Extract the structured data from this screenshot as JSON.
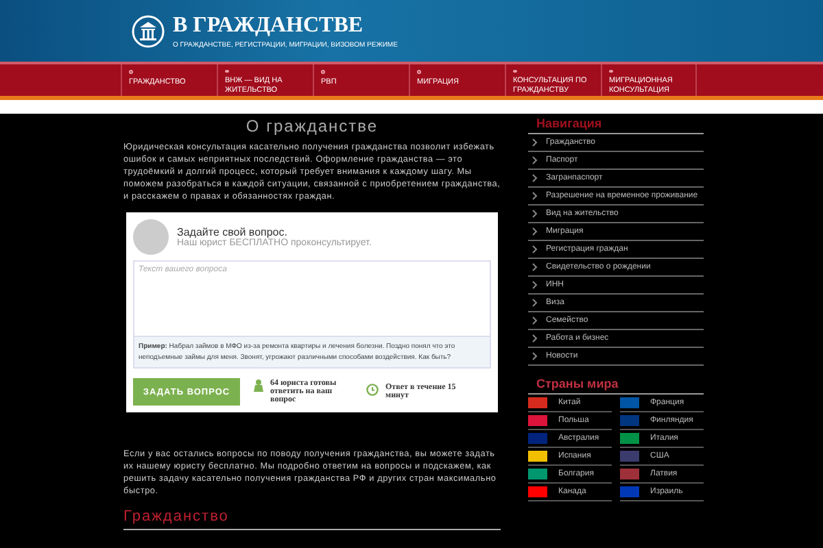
{
  "header": {
    "title": "В ГРАЖДАНСТВЕ",
    "subtitle": "О ГРАЖДАНСТВЕ, РЕГИСТРАЦИИ, МИГРАЦИИ, ВИЗОВОМ РЕЖИМЕ"
  },
  "menu": [
    "ГРАЖДАНСТВО",
    "ВНЖ — ВИД НА ЖИТЕЛЬСТВО",
    "РВП",
    "МИГРАЦИЯ",
    "КОНСУЛЬТАЦИЯ ПО ГРАЖДАНСТВУ",
    "МИГРАЦИОННАЯ КОНСУЛЬТАЦИЯ"
  ],
  "main": {
    "heading": "О гражданстве",
    "intro": "Юридическая консультация касательно получения гражданства позволит избежать ошибок и самых неприятных последствий. Оформление гражданства — это трудоёмкий и долгий процесс, который требует внимания к каждому шагу. Мы поможем разобраться в каждой ситуации, связанной с приобретением гражданства, и расскажем о правах и обязанностях граждан.",
    "question_form": {
      "title": "Задайте свой вопрос.",
      "subtitle": "Наш юрист БЕСПЛАТНО проконсультирует.",
      "placeholder": "Текст вашего вопроса",
      "example": "**Пример:** Набрал займов в МФО из-за ремонта квартиры и лечения болезни. Поздно понял что это неподъемные займы для меня. Звонят, угрожают различными способами воздействия. Как быть?",
      "button": "ЗАДАТЬ ВОПРОС",
      "lawyers": "64 юриста готовы ответить на ваш вопрос",
      "answer_time": "Ответ в течение 15 минут"
    },
    "outro": "Если у вас остались вопросы по поводу получения гражданства, вы можете задать их нашему юристу бесплатно. Мы подробно ответим на вопросы и подскажем, как решить задачу касательно получения гражданства РФ и других стран максимально быстро.",
    "section_heading": "Гражданство"
  },
  "sidebar": {
    "nav_heading": "Навигация",
    "nav": [
      "Гражданство",
      "Паспорт",
      "Загранпаспорт",
      "Разрешение на временное проживание",
      "Вид на жительство",
      "Миграция",
      "Регистрация граждан",
      "Свидетельство о рождении",
      "ИНН",
      "Виза",
      "Семейство",
      "Работа и бизнес",
      "Новости"
    ],
    "countries_heading": "Страны мира",
    "countries": [
      {
        "name": "Китай",
        "color": "#d52b1e"
      },
      {
        "name": "Франция",
        "color": "#0055a4"
      },
      {
        "name": "Польша",
        "color": "#dc143c"
      },
      {
        "name": "Финляндия",
        "color": "#003580"
      },
      {
        "name": "Австралия",
        "color": "#00247d"
      },
      {
        "name": "Италия",
        "color": "#009246"
      },
      {
        "name": "Испания",
        "color": "#f1bf00"
      },
      {
        "name": "США",
        "color": "#3c3b6e"
      },
      {
        "name": "Болгария",
        "color": "#00966e"
      },
      {
        "name": "Латвия",
        "color": "#9e3039"
      },
      {
        "name": "Канада",
        "color": "#ff0000"
      },
      {
        "name": "Израиль",
        "color": "#0038b8"
      }
    ]
  }
}
